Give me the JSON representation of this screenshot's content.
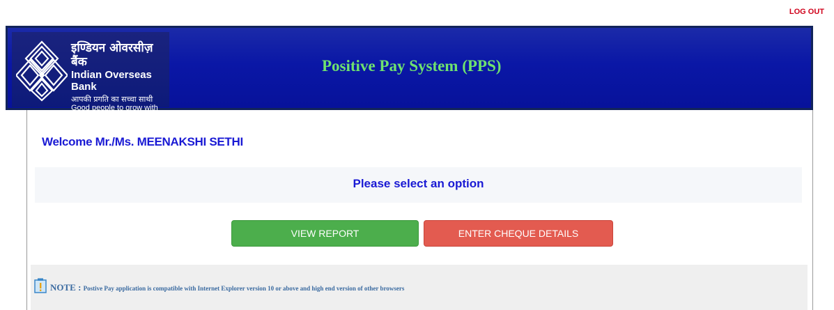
{
  "top": {
    "logout_label": "LOG OUT"
  },
  "header": {
    "logo": {
      "hindi_name": "इण्डियन ओवरसीज़ बैंक",
      "english_name": "Indian Overseas Bank",
      "hindi_tagline": "आपकी प्रगति का सच्चा साथी",
      "english_tagline": "Good people to grow with"
    },
    "title": "Positive Pay System (PPS)"
  },
  "main": {
    "welcome": "Welcome Mr./Ms. MEENAKSHI SETHI",
    "select_prompt": "Please select an option",
    "buttons": {
      "view_report": "VIEW REPORT",
      "enter_cheque": "ENTER CHEQUE DETAILS"
    },
    "note": {
      "lead": "NOTE : ",
      "text": "Postive Pay application is compatible with Internet Explorer version 10 or above and high end version of other browsers"
    }
  },
  "colors": {
    "header_bg": "#0a17a6",
    "title": "#6fe26f",
    "welcome": "#1a1ad4",
    "view_button": "#4cae4c",
    "enter_button": "#e35b50",
    "logout": "#d0021b"
  }
}
